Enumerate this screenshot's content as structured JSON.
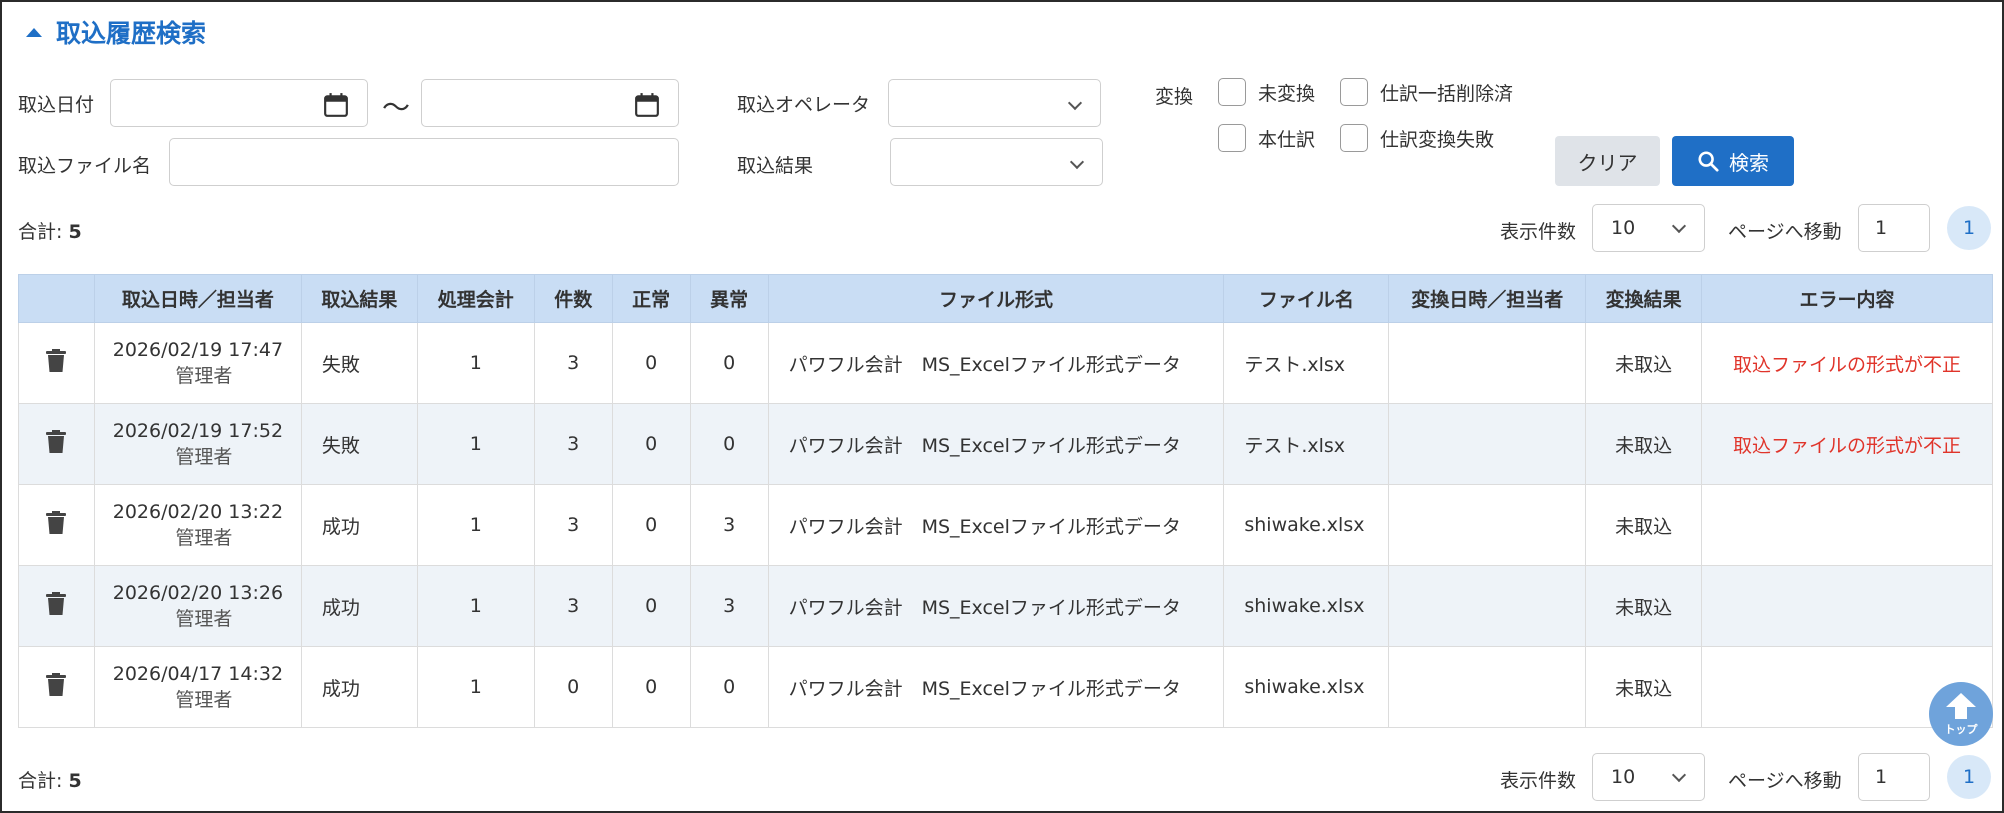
{
  "section": {
    "title": "取込履歴検索"
  },
  "filters": {
    "import_date_label": "取込日付",
    "date_from": "",
    "date_to": "",
    "tilde": "～",
    "operator_label": "取込オペレータ",
    "operator_value": "",
    "file_name_label": "取込ファイル名",
    "file_name_value": "",
    "result_label": "取込結果",
    "result_value": "",
    "convert_label": "変換",
    "checkboxes": [
      {
        "label": "未変換",
        "checked": false
      },
      {
        "label": "仕訳一括削除済",
        "checked": false
      },
      {
        "label": "本仕訳",
        "checked": false
      },
      {
        "label": "仕訳変換失敗",
        "checked": false
      }
    ],
    "clear_button": "クリア",
    "search_button": "検索"
  },
  "pager_top": {
    "total_label": "合計:",
    "total_value": "5",
    "per_page_label": "表示件数",
    "per_page_value": "10",
    "goto_label": "ページへ移動",
    "goto_value": "1",
    "current_page": "1"
  },
  "pager_bottom": {
    "total_label": "合計:",
    "total_value": "5",
    "per_page_label": "表示件数",
    "per_page_value": "10",
    "goto_label": "ページへ移動",
    "goto_value": "1",
    "current_page": "1"
  },
  "table": {
    "headers": [
      "",
      "取込日時／担当者",
      "取込結果",
      "処理会計",
      "件数",
      "正常",
      "異常",
      "ファイル形式",
      "ファイル名",
      "変換日時／担当者",
      "変換結果",
      "エラー内容"
    ],
    "rows": [
      {
        "datetime": "2026/02/19 17:47",
        "operator": "管理者",
        "result": "失敗",
        "account": "1",
        "count": "3",
        "normal": "0",
        "abnormal": "0",
        "format": "パワフル会計　MS_Excelファイル形式データ",
        "file": "テスト.xlsx",
        "conv_datetime": "",
        "conv_result": "未取込",
        "error": "取込ファイルの形式が不正"
      },
      {
        "datetime": "2026/02/19 17:52",
        "operator": "管理者",
        "result": "失敗",
        "account": "1",
        "count": "3",
        "normal": "0",
        "abnormal": "0",
        "format": "パワフル会計　MS_Excelファイル形式データ",
        "file": "テスト.xlsx",
        "conv_datetime": "",
        "conv_result": "未取込",
        "error": "取込ファイルの形式が不正"
      },
      {
        "datetime": "2026/02/20 13:22",
        "operator": "管理者",
        "result": "成功",
        "account": "1",
        "count": "3",
        "normal": "0",
        "abnormal": "3",
        "format": "パワフル会計　MS_Excelファイル形式データ",
        "file": "shiwake.xlsx",
        "conv_datetime": "",
        "conv_result": "未取込",
        "error": ""
      },
      {
        "datetime": "2026/02/20 13:26",
        "operator": "管理者",
        "result": "成功",
        "account": "1",
        "count": "3",
        "normal": "0",
        "abnormal": "3",
        "format": "パワフル会計　MS_Excelファイル形式データ",
        "file": "shiwake.xlsx",
        "conv_datetime": "",
        "conv_result": "未取込",
        "error": ""
      },
      {
        "datetime": "2026/04/17 14:32",
        "operator": "管理者",
        "result": "成功",
        "account": "1",
        "count": "0",
        "normal": "0",
        "abnormal": "0",
        "format": "パワフル会計　MS_Excelファイル形式データ",
        "file": "shiwake.xlsx",
        "conv_datetime": "",
        "conv_result": "未取込",
        "error": ""
      }
    ]
  },
  "to_top": {
    "label": "トップ"
  },
  "colors": {
    "accent": "#1f6fc6",
    "header_bg": "#c9ddf4",
    "error": "#e0342a",
    "alt_row": "#eef3f8"
  },
  "icons": {
    "delete": "trash-icon",
    "calendar": "calendar-icon",
    "search": "search-icon",
    "to_top": "arrow-up-icon"
  }
}
